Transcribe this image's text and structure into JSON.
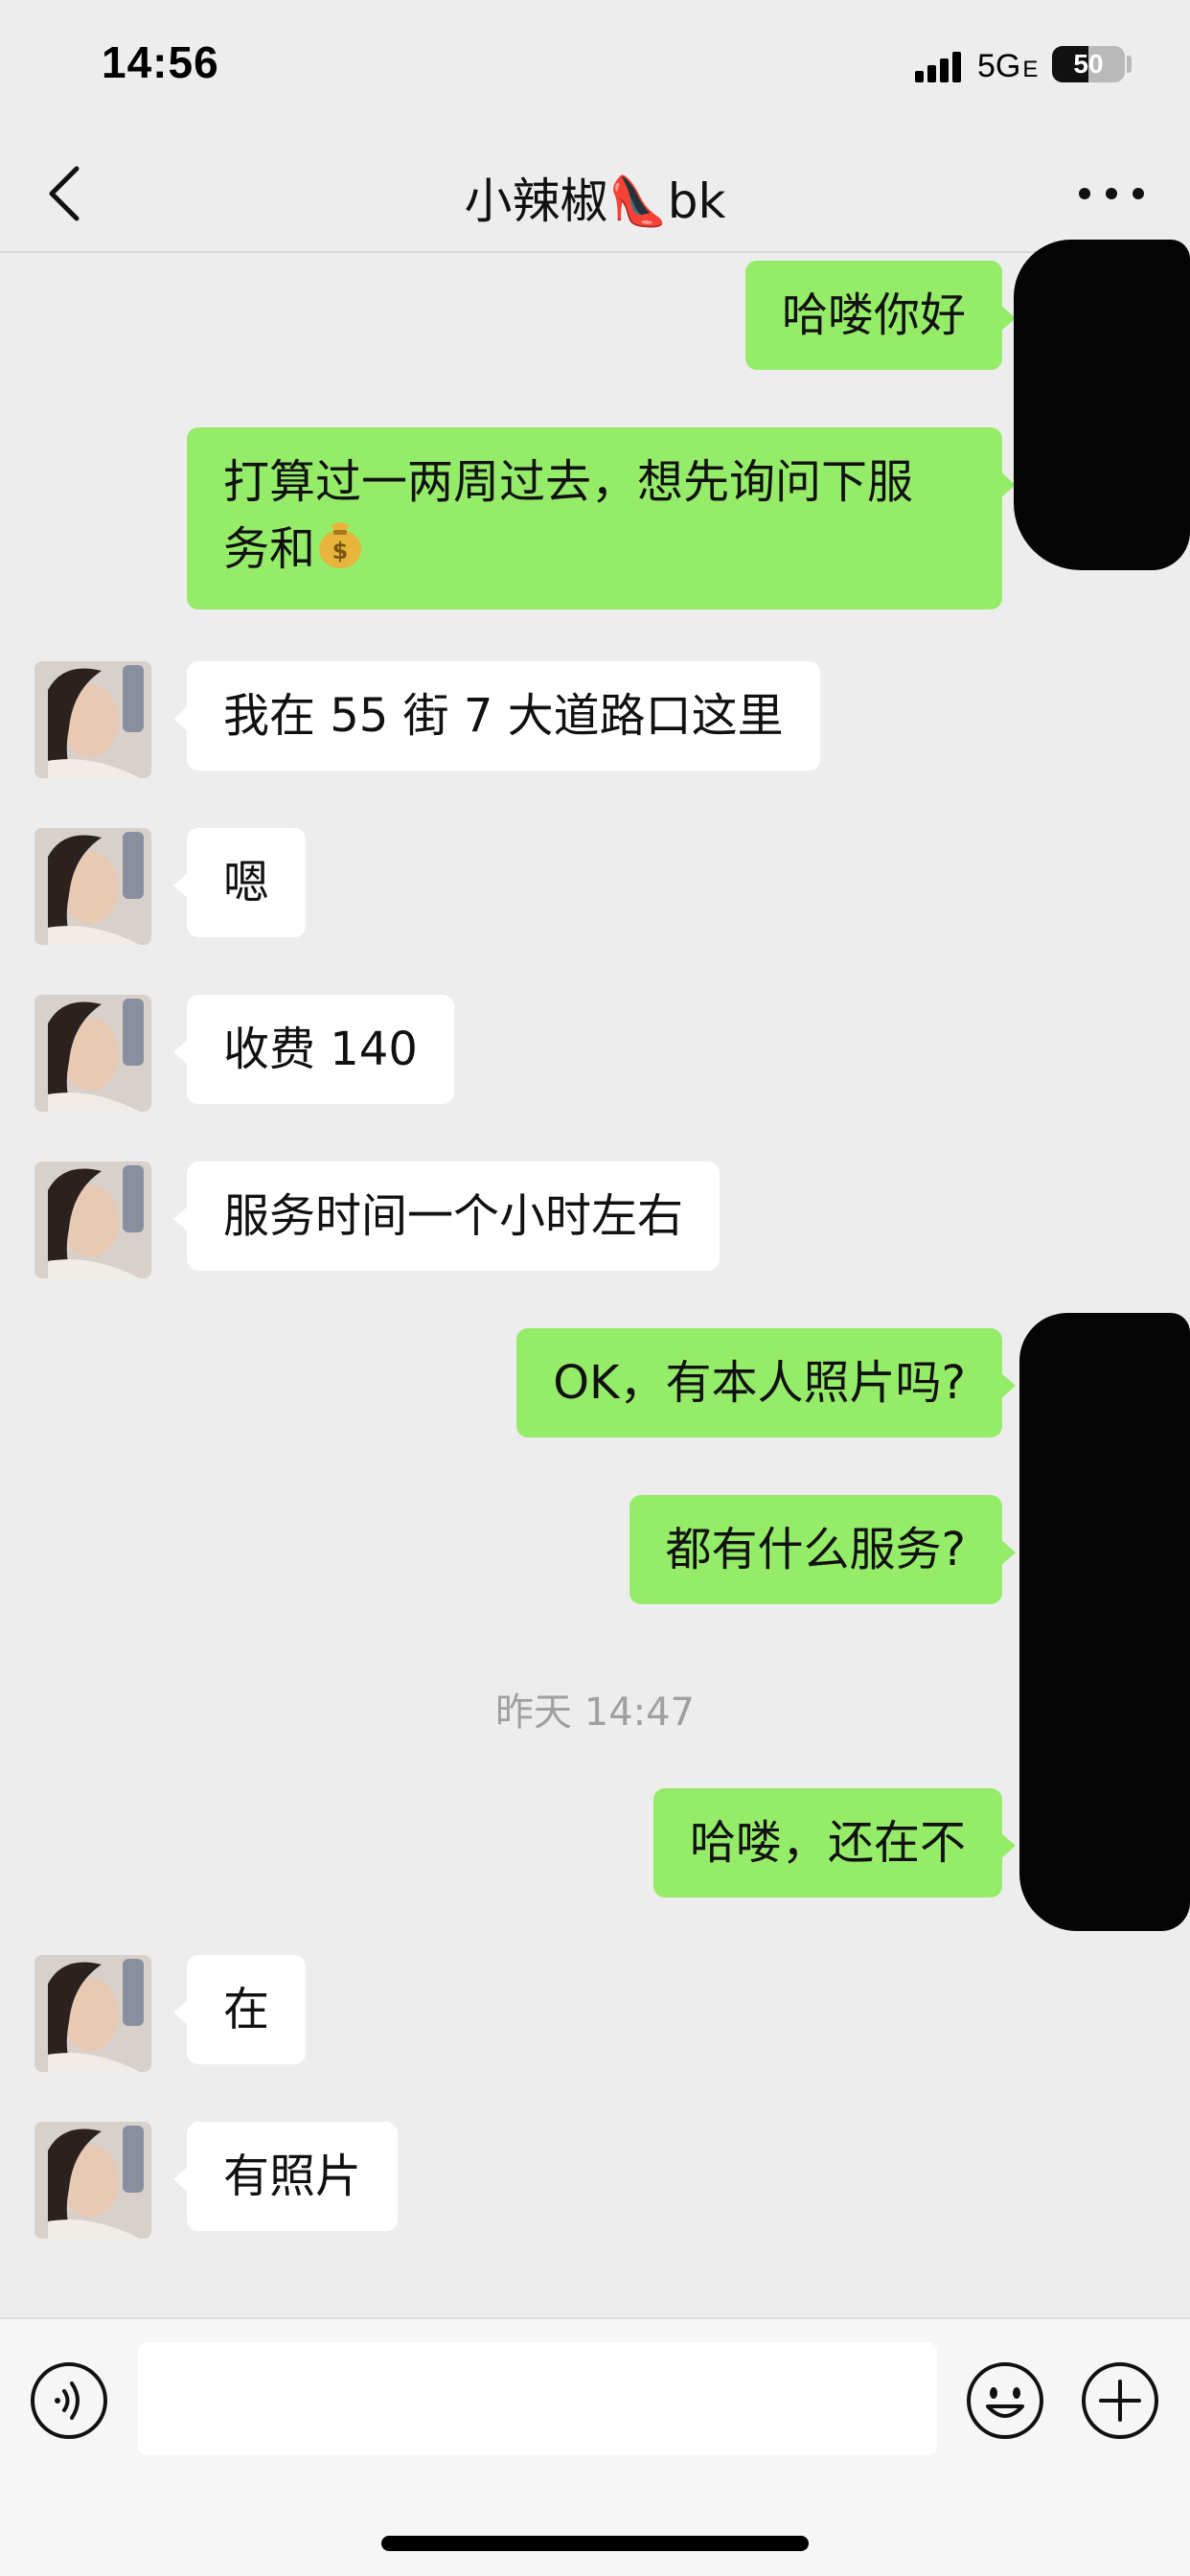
{
  "status_bar": {
    "time": "14:56",
    "network": "5G",
    "network_sub": "E",
    "battery": "50",
    "battery_level": 0.5
  },
  "nav": {
    "title": "小辣椒👠bk",
    "back_icon": "chevron-left-icon",
    "more_icon": "more-dots-icon"
  },
  "messages": [
    {
      "side": "out",
      "text": "哈喽你好"
    },
    {
      "side": "out",
      "text": "打算过一两周过去，想先询问下服\n务和"
    },
    {
      "side": "in",
      "text": "我在 55 街 7 大道路口这里"
    },
    {
      "side": "in",
      "text": "嗯"
    },
    {
      "side": "in",
      "text": "收费 140"
    },
    {
      "side": "in",
      "text": "服务时间一个小时左右"
    },
    {
      "side": "out",
      "text": "OK，有本人照片吗?"
    },
    {
      "side": "out",
      "text": "都有什么服务?"
    },
    {
      "side": "out",
      "text": "哈喽，还在不"
    },
    {
      "side": "in",
      "text": "在"
    },
    {
      "side": "in",
      "text": "有照片"
    }
  ],
  "timestamp": "昨天 14:47",
  "input_bar": {
    "placeholder": "",
    "voice_icon": "voice-icon",
    "emoji_icon": "emoji-icon",
    "plus_icon": "plus-icon"
  },
  "colors": {
    "background": "#ededed",
    "outgoing_bubble": "#95ec69",
    "incoming_bubble": "#ffffff",
    "timestamp": "#a0a0a0"
  }
}
